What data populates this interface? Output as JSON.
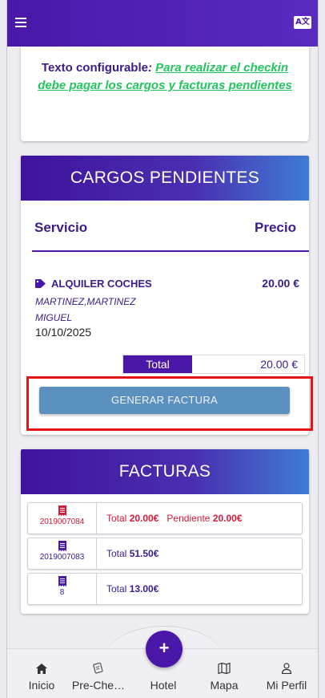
{
  "header": {
    "translate_label": "A文"
  },
  "notice": {
    "prefix": "Texto configurable",
    "colon": ":",
    "link_text": "Para realizar el checkin debe pagar los cargos y facturas pendientes"
  },
  "cargos": {
    "title": "CARGOS PENDIENTES",
    "col_service": "Servicio",
    "col_price": "Precio",
    "items": [
      {
        "name": "ALQUILER COCHES",
        "client": "MARTINEZ,MARTINEZ MIGUEL",
        "date": "10/10/2025",
        "price": "20.00 €"
      }
    ],
    "total_label": "Total",
    "total_value": "20.00 €",
    "button_label": "GENERAR FACTURA"
  },
  "facturas": {
    "title": "FACTURAS",
    "items": [
      {
        "number": "2019007084",
        "total_label": "Total",
        "total": "20.00€",
        "pending_label": "Pendiente",
        "pending": "20.00€"
      },
      {
        "number": "2019007083",
        "total_label": "Total",
        "total": "51.50€"
      },
      {
        "number": "8",
        "total_label": "Total",
        "total": "13.00€"
      }
    ]
  },
  "nav": {
    "fab_label": "+",
    "items": [
      {
        "label": "Inicio",
        "icon": "home-icon"
      },
      {
        "label": "Pre-Che…",
        "icon": "pre-checkin-icon"
      },
      {
        "label": "Hotel",
        "icon": "hotel-icon"
      },
      {
        "label": "Mapa",
        "icon": "map-icon"
      },
      {
        "label": "Mi Perfil",
        "icon": "profile-icon"
      }
    ]
  },
  "colors": {
    "primary": "#4a17a8",
    "accent_green": "#22c55e",
    "button": "#5b91bf",
    "highlight": "#e41414",
    "pending_red": "#d21a3a"
  }
}
